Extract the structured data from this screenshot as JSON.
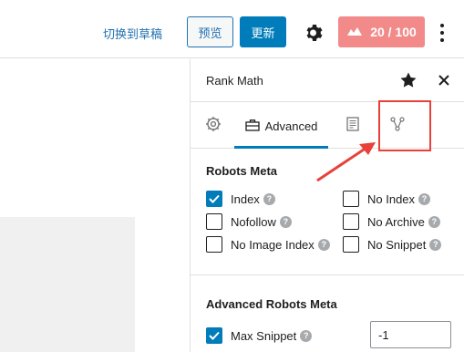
{
  "toolbar": {
    "switch_to_draft": "切换到草稿",
    "preview": "预览",
    "update": "更新",
    "seo_score": "20 / 100"
  },
  "sidebar": {
    "title": "Rank Math",
    "tabs": [
      {
        "label": ""
      },
      {
        "label": "Advanced"
      },
      {
        "label": ""
      },
      {
        "label": ""
      }
    ],
    "robots_meta": {
      "title": "Robots Meta",
      "options": [
        {
          "label": "Index",
          "checked": true
        },
        {
          "label": "No Index",
          "checked": false
        },
        {
          "label": "Nofollow",
          "checked": false
        },
        {
          "label": "No Archive",
          "checked": false
        },
        {
          "label": "No Image Index",
          "checked": false
        },
        {
          "label": "No Snippet",
          "checked": false
        }
      ]
    },
    "advanced_robots_meta": {
      "title": "Advanced Robots Meta",
      "max_snippet_label": "Max Snippet",
      "max_snippet_checked": true,
      "max_snippet_value": "-1"
    }
  },
  "colors": {
    "primary": "#007cba",
    "score_bg": "#f28a8a",
    "annotation": "#e8413a"
  }
}
